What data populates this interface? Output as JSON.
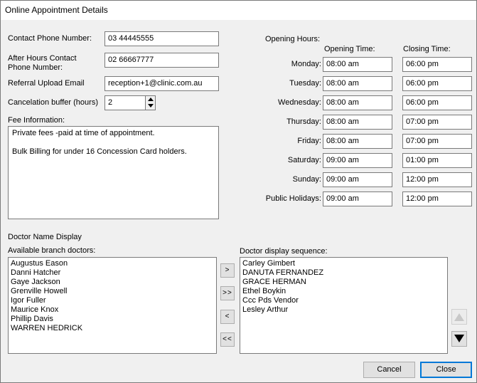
{
  "window": {
    "title": "Online Appointment Details"
  },
  "contact": {
    "phone_label": "Contact Phone Number:",
    "phone_value": "03 44445555",
    "after_hours_label_line1": "After Hours Contact",
    "after_hours_label_line2": "Phone Number:",
    "after_hours_value": "02 66667777",
    "referral_label": "Referral Upload Email",
    "referral_value": "reception+1@clinic.com.au",
    "buffer_label": "Cancelation buffer (hours)",
    "buffer_value": "2"
  },
  "fee": {
    "label": "Fee Information:",
    "line1": "Private fees -paid at time of appointment.",
    "line2": "Bulk Billing for under 16 Concession Card holders."
  },
  "hours": {
    "label": "Opening Hours:",
    "opening_header": "Opening Time:",
    "closing_header": "Closing Time:",
    "days": [
      {
        "day": "Monday:",
        "open": "08:00 am",
        "close": "06:00 pm"
      },
      {
        "day": "Tuesday:",
        "open": "08:00 am",
        "close": "06:00 pm"
      },
      {
        "day": "Wednesday:",
        "open": "08:00 am",
        "close": "06:00 pm"
      },
      {
        "day": "Thursday:",
        "open": "08:00 am",
        "close": "07:00 pm"
      },
      {
        "day": "Friday:",
        "open": "08:00 am",
        "close": "07:00 pm"
      },
      {
        "day": "Saturday:",
        "open": "09:00 am",
        "close": "01:00 pm"
      },
      {
        "day": "Sunday:",
        "open": "09:00 am",
        "close": "12:00 pm"
      },
      {
        "day": "Public Holidays:",
        "open": "09:00 am",
        "close": "12:00 pm"
      }
    ]
  },
  "doctors": {
    "section_label": "Doctor Name Display",
    "available_label": "Available branch doctors:",
    "available": [
      "Augustus Eason",
      "Danni Hatcher",
      "Gaye Jackson",
      "Grenville Howell",
      "Igor Fuller",
      "Maurice Knox",
      "Phillip Davis",
      "WARREN HEDRICK"
    ],
    "sequence_label": "Doctor display sequence:",
    "sequence": [
      "Carley Gimbert",
      "DANUTA FERNANDEZ",
      "GRACE HERMAN",
      "Ethel Boykin",
      "Ccc Pds Vendor",
      "Lesley Arthur"
    ],
    "move_right": ">",
    "move_all_right": ">>",
    "move_left": "<",
    "move_all_left": "<<"
  },
  "footer": {
    "cancel_label": "Cancel",
    "close_label": "Close"
  },
  "icons": {
    "spin_up": "spin-up-icon",
    "spin_down": "spin-down-icon",
    "move_up": "triangle-up-icon",
    "move_down": "triangle-down-icon"
  }
}
